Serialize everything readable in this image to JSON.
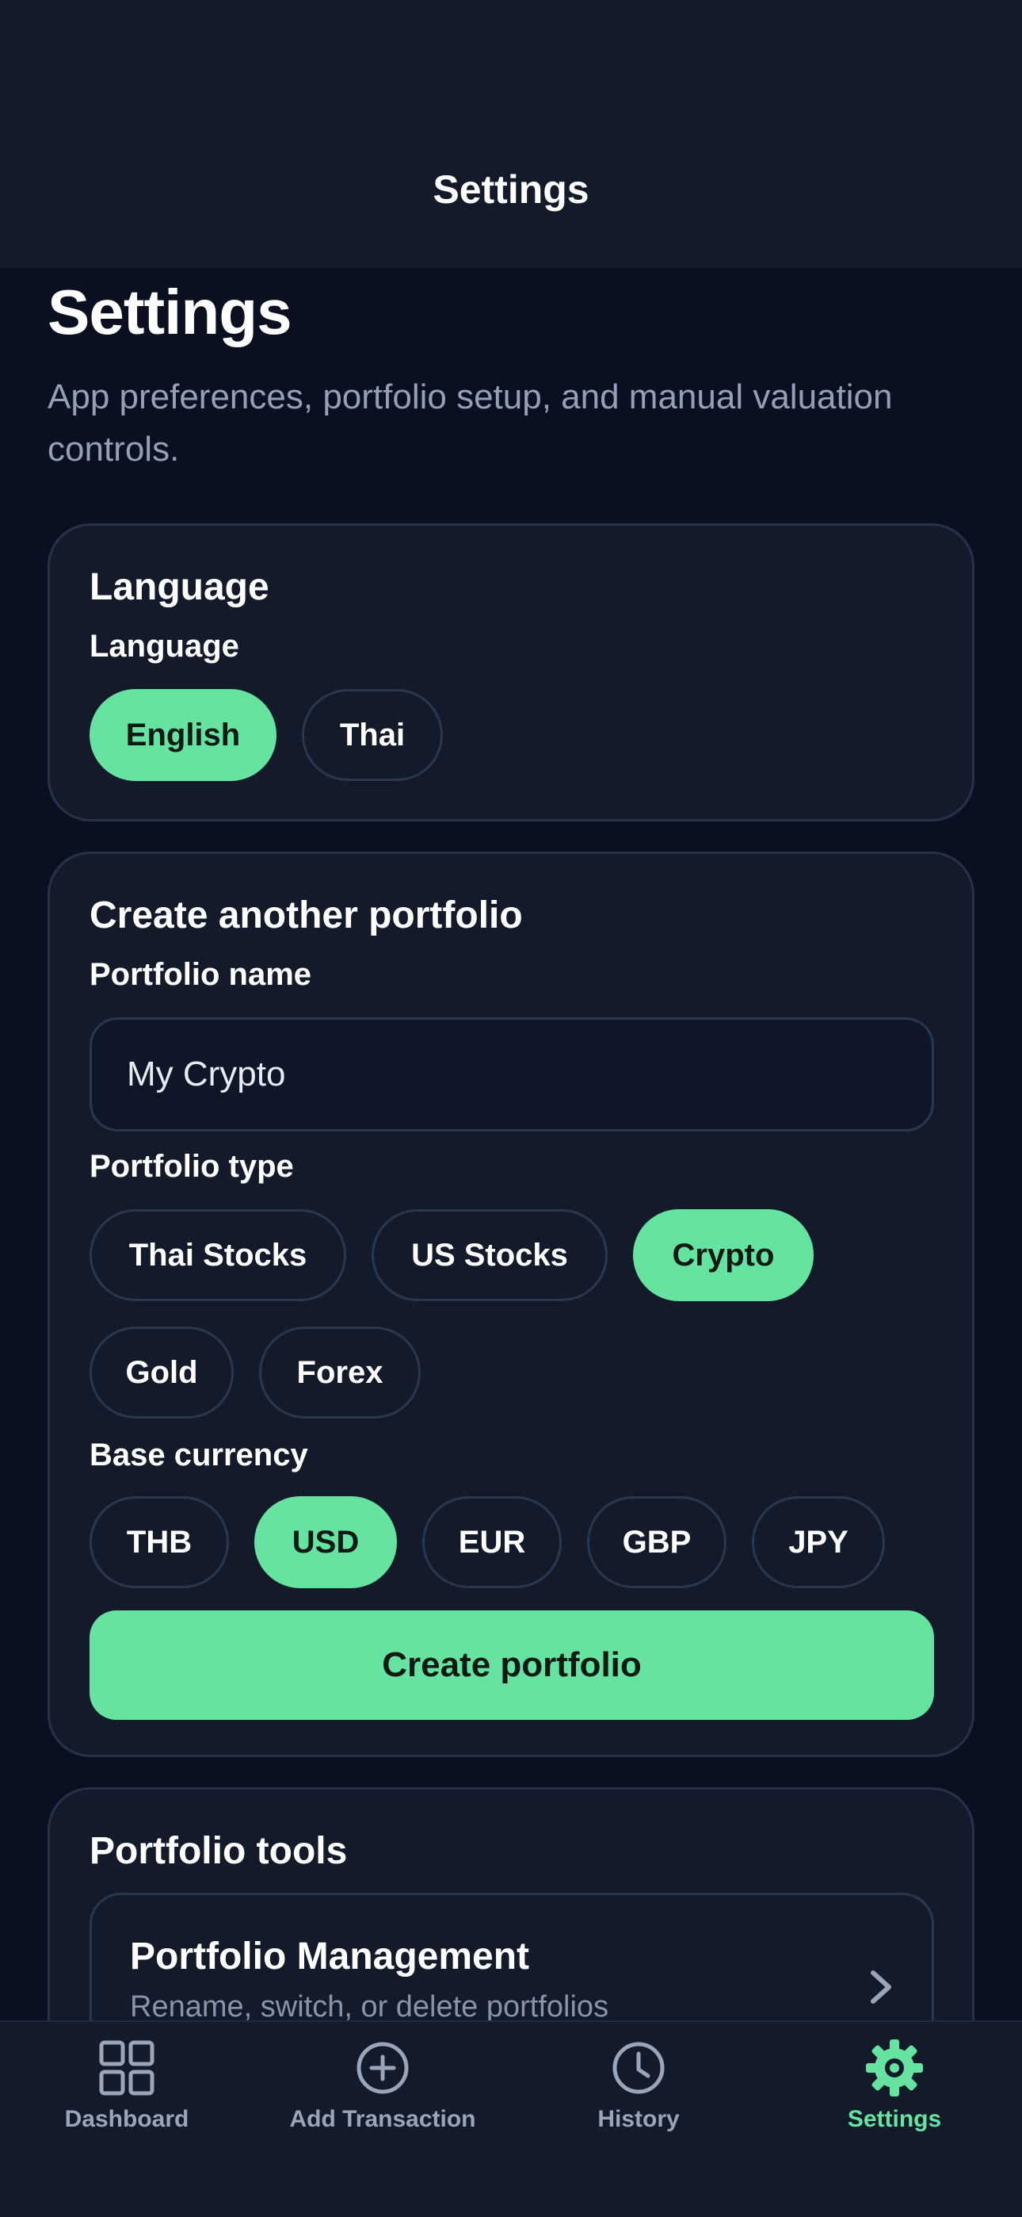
{
  "navbar": {
    "title": "Settings"
  },
  "page": {
    "title": "Settings",
    "subtitle": "App preferences, portfolio setup, and manual valuation controls."
  },
  "language_card": {
    "title": "Language",
    "label": "Language",
    "options": [
      "English",
      "Thai"
    ],
    "selected": "English"
  },
  "create_card": {
    "title": "Create another portfolio",
    "name_label": "Portfolio name",
    "name_value": "My Crypto",
    "type_label": "Portfolio type",
    "types": [
      "Thai Stocks",
      "US Stocks",
      "Crypto",
      "Gold",
      "Forex"
    ],
    "selected_type": "Crypto",
    "currency_label": "Base currency",
    "currencies": [
      "THB",
      "USD",
      "EUR",
      "GBP",
      "JPY"
    ],
    "selected_currency": "USD",
    "create_button": "Create portfolio"
  },
  "tools_card": {
    "title": "Portfolio tools",
    "items": [
      {
        "title": "Portfolio Management",
        "subtitle": "Rename, switch, or delete portfolios",
        "icon": "chevron-right-icon"
      }
    ]
  },
  "tabbar": {
    "tabs": [
      {
        "label": "Dashboard",
        "icon": "grid-icon"
      },
      {
        "label": "Add Transaction",
        "icon": "plus-circle-icon"
      },
      {
        "label": "History",
        "icon": "clock-icon"
      },
      {
        "label": "Settings",
        "icon": "gear-icon"
      }
    ],
    "active": "Settings"
  },
  "colors": {
    "accent": "#66e3a1",
    "background": "#0a1020",
    "card": "#131b2b",
    "border": "#263247",
    "muted_text": "#94a0b6"
  }
}
